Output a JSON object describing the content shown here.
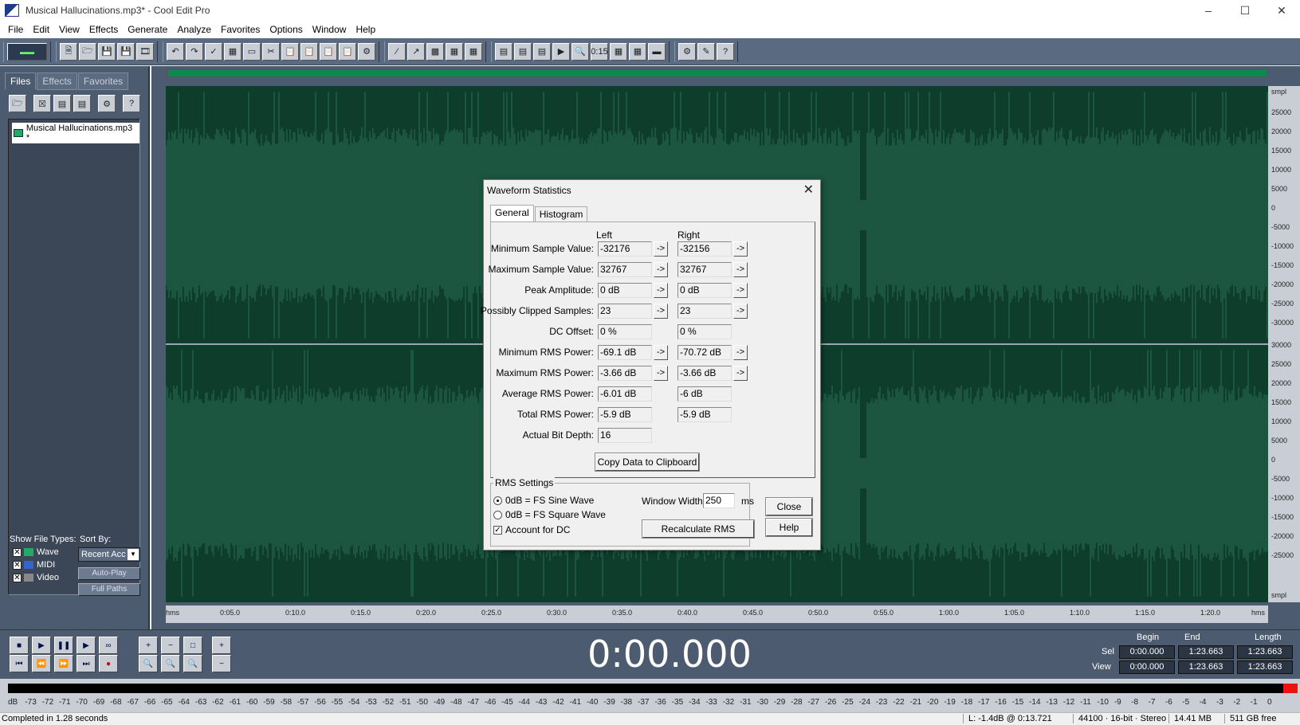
{
  "window": {
    "title": "Musical Hallucinations.mp3* - Cool Edit Pro"
  },
  "menu": [
    "File",
    "Edit",
    "View",
    "Effects",
    "Generate",
    "Analyze",
    "Favorites",
    "Options",
    "Window",
    "Help"
  ],
  "organizer": {
    "tabs": [
      "Files",
      "Effects",
      "Favorites"
    ],
    "file": "Musical Hallucinations.mp3 *",
    "show_label": "Show File Types:",
    "sort_label": "Sort By:",
    "types": [
      "Wave",
      "MIDI",
      "Video"
    ],
    "sort_value": "Recent Acc",
    "autoplay": "Auto-Play",
    "fullpaths": "Full Paths"
  },
  "scale": {
    "unit": "smpl",
    "top_labels": [
      "25000",
      "20000",
      "15000",
      "10000",
      "5000",
      "0",
      "-5000",
      "-10000",
      "-15000",
      "-20000",
      "-25000",
      "-30000"
    ],
    "bottom_labels": [
      "30000",
      "25000",
      "20000",
      "15000",
      "10000",
      "5000",
      "0",
      "-5000",
      "-10000",
      "-15000",
      "-20000",
      "-25000"
    ],
    "bottom_unit": "smpl"
  },
  "timeline": [
    "hms",
    "0:05.0",
    "0:10.0",
    "0:15.0",
    "0:20.0",
    "0:25.0",
    "0:30.0",
    "0:35.0",
    "0:40.0",
    "0:45.0",
    "0:50.0",
    "0:55.0",
    "1:00.0",
    "1:05.0",
    "1:10.0",
    "1:15.0",
    "1:20.0",
    "hms"
  ],
  "transport": {
    "time": "0:00.000"
  },
  "selection": {
    "headers": [
      "Begin",
      "End",
      "Length"
    ],
    "sel_label": "Sel",
    "view_label": "View",
    "sel": [
      "0:00.000",
      "1:23.663",
      "1:23.663"
    ],
    "view": [
      "0:00.000",
      "1:23.663",
      "1:23.663"
    ]
  },
  "meter": [
    "dB",
    "-73",
    "-72",
    "-71",
    "-70",
    "-69",
    "-68",
    "-67",
    "-66",
    "-65",
    "-64",
    "-63",
    "-62",
    "-61",
    "-60",
    "-59",
    "-58",
    "-57",
    "-56",
    "-55",
    "-54",
    "-53",
    "-52",
    "-51",
    "-50",
    "-49",
    "-48",
    "-47",
    "-46",
    "-45",
    "-44",
    "-43",
    "-42",
    "-41",
    "-40",
    "-39",
    "-38",
    "-37",
    "-36",
    "-35",
    "-34",
    "-33",
    "-32",
    "-31",
    "-30",
    "-29",
    "-28",
    "-27",
    "-26",
    "-25",
    "-24",
    "-23",
    "-22",
    "-21",
    "-20",
    "-19",
    "-18",
    "-17",
    "-16",
    "-15",
    "-14",
    "-13",
    "-12",
    "-11",
    "-10",
    "-9",
    "-8",
    "-7",
    "-6",
    "-5",
    "-4",
    "-3",
    "-2",
    "-1",
    "0"
  ],
  "status": {
    "message": "Completed in 1.28 seconds",
    "level": "L: -1.4dB @  0:13.721",
    "format": "44100 · 16-bit · Stereo",
    "size": "14.41 MB",
    "free": "511 GB free"
  },
  "dialog": {
    "title": "Waveform Statistics",
    "tabs": [
      "General",
      "Histogram"
    ],
    "col_left": "Left",
    "col_right": "Right",
    "rows": [
      {
        "label": "Minimum Sample Value:",
        "left": "-32176",
        "right": "-32156",
        "arrows": true
      },
      {
        "label": "Maximum Sample Value:",
        "left": "32767",
        "right": "32767",
        "arrows": true
      },
      {
        "label": "Peak Amplitude:",
        "left": "0 dB",
        "right": "0 dB",
        "arrows": true
      },
      {
        "label": "Possibly Clipped Samples:",
        "left": "23",
        "right": "23",
        "arrows": true
      },
      {
        "label": "DC Offset:",
        "left": "0 %",
        "right": "0 %",
        "arrows": false
      },
      {
        "label": "Minimum RMS Power:",
        "left": "-69.1 dB",
        "right": "-70.72 dB",
        "arrows": true
      },
      {
        "label": "Maximum RMS Power:",
        "left": "-3.66 dB",
        "right": "-3.66 dB",
        "arrows": true
      },
      {
        "label": "Average RMS Power:",
        "left": "-6.01 dB",
        "right": "-6 dB",
        "arrows": false
      },
      {
        "label": "Total RMS Power:",
        "left": "-5.9 dB",
        "right": "-5.9 dB",
        "arrows": false
      },
      {
        "label": "Actual Bit Depth:",
        "left": "16",
        "right": "",
        "arrows": false
      }
    ],
    "arrow_glyph": "->",
    "copy_button": "Copy Data to Clipboard",
    "rms_title": "RMS Settings",
    "opt_sine": "0dB = FS Sine Wave",
    "opt_square": "0dB = FS Square Wave",
    "opt_dc": "Account for DC",
    "window_width_label": "Window Width:",
    "window_width_value": "250",
    "window_width_unit": "ms",
    "recalc": "Recalculate RMS",
    "close": "Close",
    "help": "Help"
  },
  "colors": {
    "waveform_bg": "#0e3d2c",
    "waveform": "#1f5c45",
    "panel": "#4d5b70"
  }
}
